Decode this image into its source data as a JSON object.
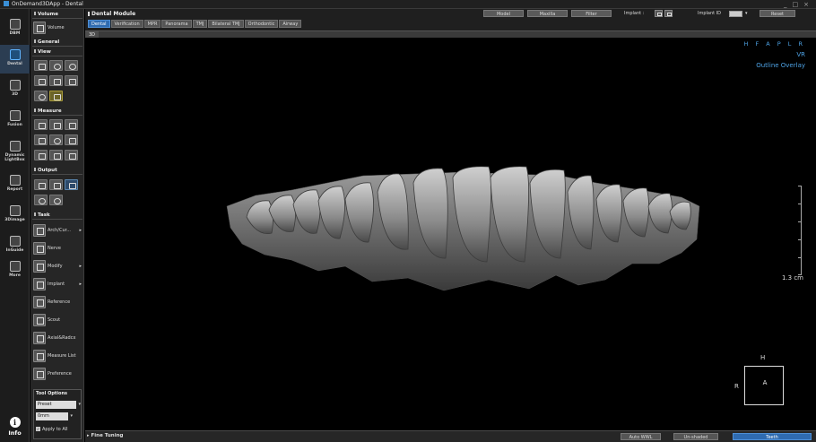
{
  "window": {
    "title": "OnDemand3DApp - Dental"
  },
  "left_nav": [
    {
      "label": "DBM",
      "icon": "database-icon"
    },
    {
      "label": "Dental",
      "icon": "tooth-icon",
      "active": true
    },
    {
      "label": "3D",
      "icon": "cube-icon"
    },
    {
      "label": "Fusion",
      "icon": "fusion-icon"
    },
    {
      "label": "Dynamic LightBox",
      "icon": "lightbox-icon"
    },
    {
      "label": "Report",
      "icon": "report-icon"
    },
    {
      "label": "3Dimage",
      "icon": "image-icon"
    },
    {
      "label": "InGuide",
      "icon": "guide-icon"
    },
    {
      "label": "More",
      "icon": "more-icon"
    }
  ],
  "info": {
    "label": "Info"
  },
  "tool_panel": {
    "volume_header": "Volume",
    "volume_button": "Volume",
    "general_header": "General",
    "view_header": "View",
    "measure_header": "Measure",
    "output_header": "Output",
    "task_header": "Task",
    "tasks": [
      {
        "label": "Arch/Cur...",
        "arrow": "▸"
      },
      {
        "label": "Nerve",
        "arrow": ""
      },
      {
        "label": "Modify",
        "arrow": "▸"
      },
      {
        "label": "Implant",
        "arrow": "▸"
      },
      {
        "label": "Reference",
        "arrow": ""
      },
      {
        "label": "Scout",
        "arrow": ""
      },
      {
        "label": "Axial&Radcx",
        "arrow": ""
      },
      {
        "label": "Measure List",
        "arrow": ""
      },
      {
        "label": "Preference",
        "arrow": ""
      }
    ],
    "tool_options": {
      "header": "Tool Options",
      "preset": "Preset",
      "unit": "0mm",
      "apply_all": "Apply to All"
    }
  },
  "header": {
    "module_title": "Dental Module",
    "tabs": [
      {
        "label": "Dental",
        "active": true
      },
      {
        "label": "Verification"
      },
      {
        "label": "MPR"
      },
      {
        "label": "Panorama"
      },
      {
        "label": "TMJ"
      },
      {
        "label": "Bilateral TMJ"
      },
      {
        "label": "Orthodontic"
      },
      {
        "label": "Airway"
      }
    ],
    "buttons": {
      "model": "Model",
      "maxilla": "Maxilla",
      "filter": "Filter",
      "reset": "Reset"
    },
    "implant_label": "Implant :",
    "implant_id_label": "Implant ID"
  },
  "viewport": {
    "tab_label": "3D",
    "orientation_letters": "H F A P L R",
    "render_mode": "VR",
    "overlay_mode": "Outline Overlay",
    "scale_label": "1.3 cm",
    "orientation_cube": {
      "top": "H",
      "left": "R",
      "center": "A"
    }
  },
  "bottom_bar": {
    "fine_tuning": "Fine Tuning",
    "buttons": [
      {
        "label": "Auto WWL"
      },
      {
        "label": "Un-shaded"
      },
      {
        "label": "Teeth",
        "active": true
      }
    ]
  },
  "colors": {
    "accent": "#2f6bb0",
    "overlay_text": "#4ea3e6"
  }
}
